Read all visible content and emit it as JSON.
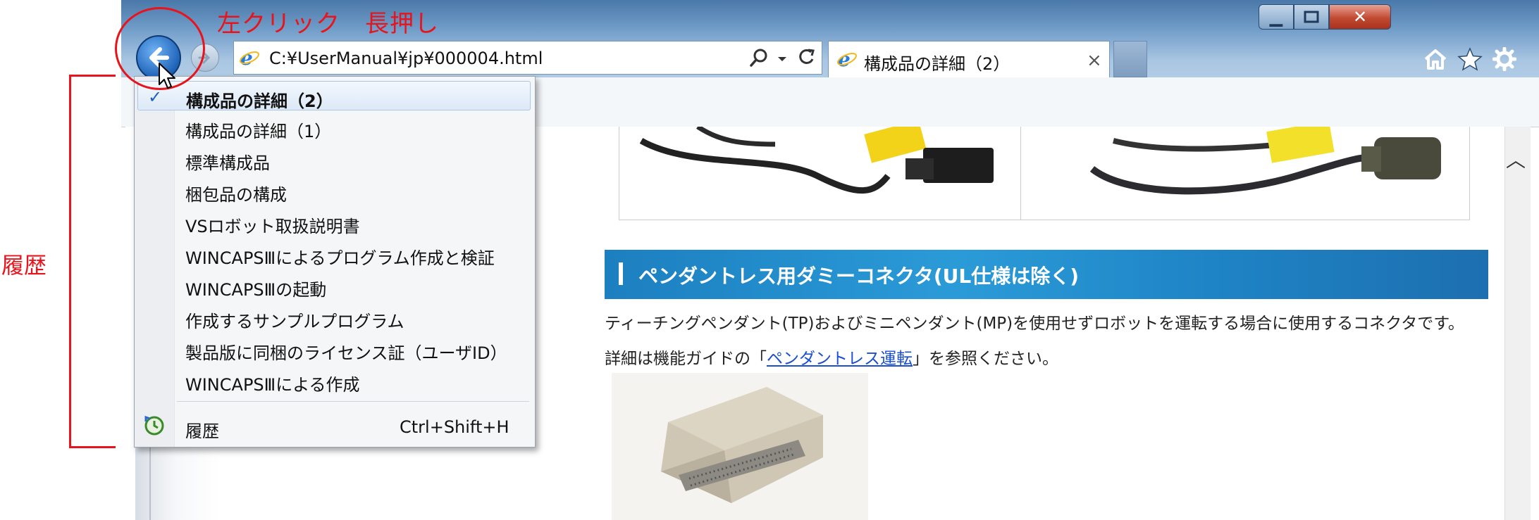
{
  "browser": {
    "address": "C:¥UserManual¥jp¥000004.html",
    "tab_title": "構成品の詳細（2）",
    "caption_buttons": [
      "minimize",
      "maximize",
      "close"
    ],
    "toolbar_icons": [
      "home-icon",
      "favorites-icon",
      "settings-icon"
    ]
  },
  "annotations": {
    "action": "左クリック　長押し",
    "history_label": "履歴",
    "color": "#e8141c"
  },
  "history_menu": {
    "items": [
      "構成品の詳細（2）",
      "構成品の詳細（1）",
      "標準構成品",
      "梱包品の構成",
      "VSロボット取扱説明書",
      "WINCAPSⅢによるプログラム作成と検証",
      "WINCAPSⅢの起動",
      "作成するサンプルプログラム",
      "製品版に同梱のライセンス証（ユーザID）",
      "WINCAPSⅢによる作成"
    ],
    "current_index": 0,
    "footer_label": "履歴",
    "footer_shortcut": "Ctrl+Shift+H"
  },
  "page": {
    "heading": "ペンダントレス用ダミーコネクタ(UL仕様は除く)",
    "desc_line_1": "ティーチングペンダント(TP)およびミニペンダント(MP)を使用せずロボットを運転する場合に使用するコネクタです。",
    "desc_line_2_prefix": "詳細は機能ガイドの「",
    "desc_line_2_link": "ペンダントレス運転",
    "desc_line_2_suffix": "」を参照ください。"
  },
  "colors": {
    "heading_blue": "#1c7fc0",
    "link_blue": "#1a4fd0"
  }
}
